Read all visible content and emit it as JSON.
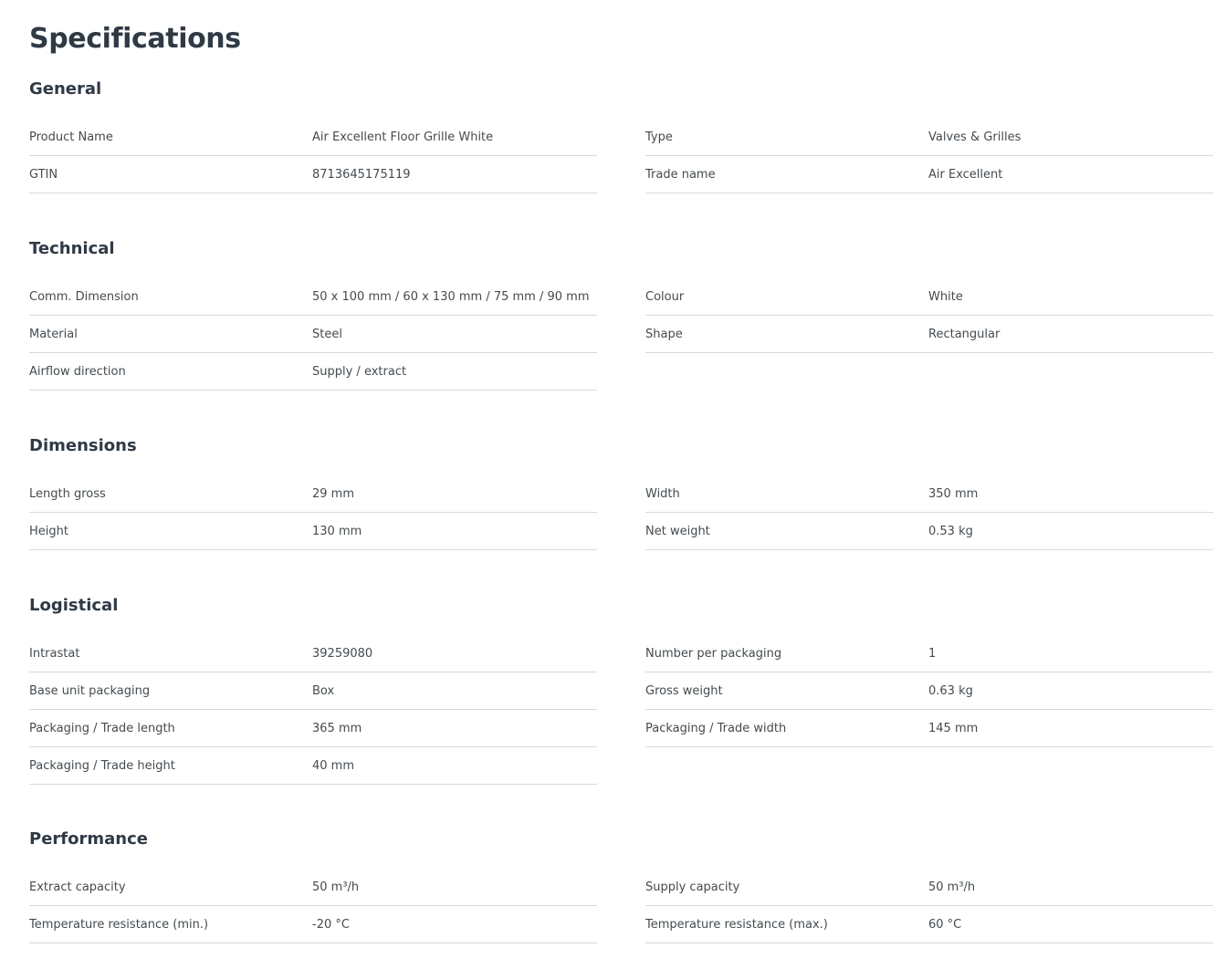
{
  "page": {
    "title": "Specifications"
  },
  "sections": {
    "general": {
      "title": "General",
      "left": [
        {
          "label": "Product Name",
          "value": "Air Excellent Floor Grille White"
        },
        {
          "label": "GTIN",
          "value": "8713645175119"
        }
      ],
      "right": [
        {
          "label": "Type",
          "value": "Valves & Grilles"
        },
        {
          "label": "Trade name",
          "value": "Air Excellent"
        }
      ]
    },
    "technical": {
      "title": "Technical",
      "left": [
        {
          "label": "Comm. Dimension",
          "value": "50 x 100 mm / 60 x 130 mm / 75 mm / 90 mm"
        },
        {
          "label": "Material",
          "value": "Steel"
        },
        {
          "label": "Airflow direction",
          "value": "Supply / extract"
        }
      ],
      "right": [
        {
          "label": "Colour",
          "value": "White"
        },
        {
          "label": "Shape",
          "value": "Rectangular"
        }
      ]
    },
    "dimensions": {
      "title": "Dimensions",
      "left": [
        {
          "label": "Length gross",
          "value": "29 mm"
        },
        {
          "label": "Height",
          "value": "130 mm"
        }
      ],
      "right": [
        {
          "label": "Width",
          "value": "350 mm"
        },
        {
          "label": "Net weight",
          "value": "0.53 kg"
        }
      ]
    },
    "logistical": {
      "title": "Logistical",
      "left": [
        {
          "label": "Intrastat",
          "value": "39259080"
        },
        {
          "label": "Base unit packaging",
          "value": "Box"
        },
        {
          "label": "Packaging / Trade length",
          "value": "365 mm"
        },
        {
          "label": "Packaging / Trade height",
          "value": "40 mm"
        }
      ],
      "right": [
        {
          "label": "Number per packaging",
          "value": "1"
        },
        {
          "label": "Gross weight",
          "value": "0.63 kg"
        },
        {
          "label": "Packaging / Trade width",
          "value": "145 mm"
        }
      ]
    },
    "performance": {
      "title": "Performance",
      "left": [
        {
          "label": "Extract capacity",
          "value": "50 m³/h"
        },
        {
          "label": "Temperature resistance (min.)",
          "value": "-20 °C"
        }
      ],
      "right": [
        {
          "label": "Supply capacity",
          "value": "50 m³/h"
        },
        {
          "label": "Temperature resistance (max.)",
          "value": "60 °C"
        }
      ]
    }
  }
}
